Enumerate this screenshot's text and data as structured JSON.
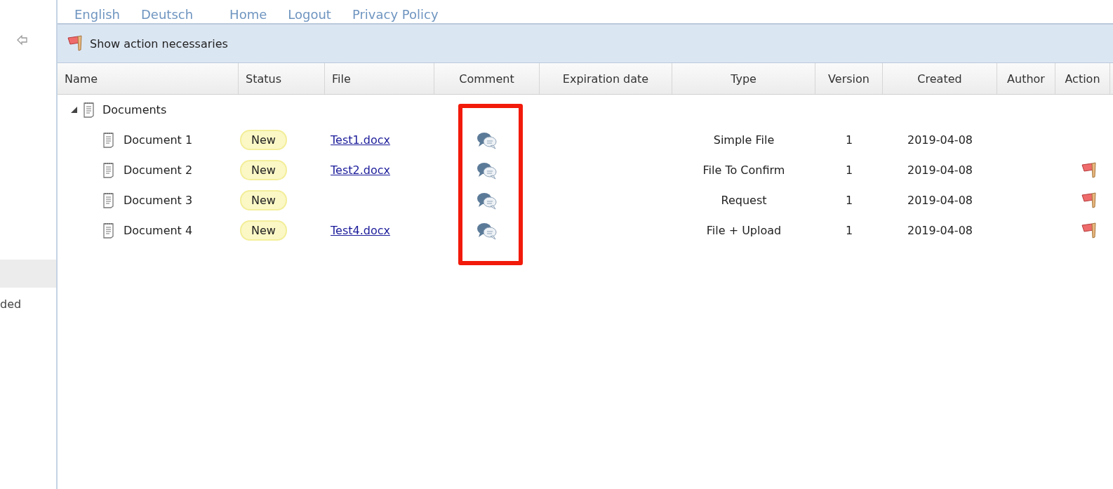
{
  "top_links": {
    "languages": [
      "English",
      "Deutsch"
    ],
    "navigation": [
      "Home",
      "Logout",
      "Privacy Policy"
    ]
  },
  "sidebar": {
    "cut_text": "ded"
  },
  "toolbar": {
    "button": "Show action necessaries"
  },
  "table": {
    "columns": [
      "Name",
      "Status",
      "File",
      "Comment",
      "Expiration date",
      "Type",
      "Version",
      "Created",
      "Author",
      "Action"
    ],
    "tree": {
      "label": "Documents",
      "expanded": true,
      "children": [
        {
          "name": "Document 1",
          "status": "New",
          "file": "Test1.docx",
          "type": "Simple File",
          "version": "1",
          "created": "2019-04-08",
          "action_needed": false
        },
        {
          "name": "Document 2",
          "status": "New",
          "file": "Test2.docx",
          "type": "File To Confirm",
          "version": "1",
          "created": "2019-04-08",
          "action_needed": true
        },
        {
          "name": "Document 3",
          "status": "New",
          "type": "Request",
          "version": "1",
          "created": "2019-04-08",
          "action_needed": true
        },
        {
          "name": "Document 4",
          "status": "New",
          "file": "Test4.docx",
          "type": "File + Upload",
          "version": "1",
          "created": "2019-04-08",
          "action_needed": true
        }
      ]
    }
  },
  "annotation": {
    "kind": "frame"
  }
}
